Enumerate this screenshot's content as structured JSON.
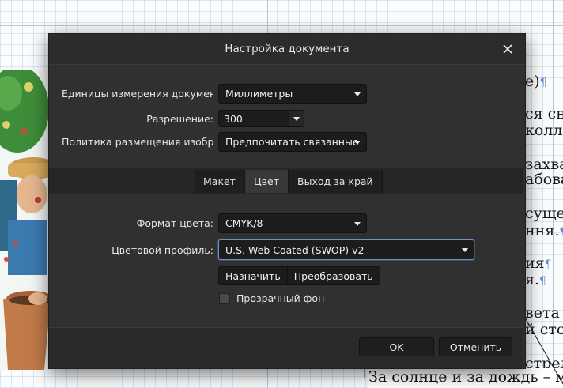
{
  "background": {
    "text_lines": [
      {
        "text": "е)",
        "pilcrow": "¶"
      },
      {
        "text": "ся сно",
        "pilcrow": ""
      },
      {
        "text": "колле",
        "pilcrow": ""
      },
      {
        "text": "захва",
        "pilcrow": ""
      },
      {
        "text": "абова",
        "pilcrow": ""
      },
      {
        "text": "суще",
        "pilcrow": ""
      },
      {
        "text": "ння.",
        "pilcrow": "¶"
      },
      {
        "text": "ия",
        "pilcrow": "¶"
      },
      {
        "text": "я.",
        "pilcrow": "¶"
      },
      {
        "text": "вета х",
        "pilcrow": ""
      },
      {
        "text": "й стор",
        "pilcrow": ""
      },
      {
        "text": "стрель",
        "pilcrow": ""
      }
    ],
    "bottom_line": "За солнце и за дождь – мо"
  },
  "dialog": {
    "title": "Настройка документа",
    "close_icon": "close-icon",
    "fields": {
      "units_label": "Единицы измерения докумен",
      "units_value": "Миллиметры",
      "resolution_label": "Разрешение:",
      "resolution_value": "300",
      "placement_label": "Политика размещения изобр",
      "placement_value": "Предпочитать связанные"
    },
    "tabs": [
      {
        "label": "Макет",
        "active": false
      },
      {
        "label": "Цвет",
        "active": true
      },
      {
        "label": "Выход за край",
        "active": false
      }
    ],
    "color": {
      "format_label": "Формат цвета:",
      "format_value": "CMYK/8",
      "profile_label": "Цветовой профиль:",
      "profile_value": "U.S. Web Coated (SWOP) v2",
      "assign_label": "Назначить",
      "convert_label": "Преобразовать",
      "transparent_label": "Прозрачный фон",
      "transparent_checked": false
    },
    "footer": {
      "ok_label": "OK",
      "cancel_label": "Отменить"
    }
  },
  "colors": {
    "dialog_bg": "#303030",
    "accent_focus": "#6f8fc9",
    "pilcrow": "#5c8fd6"
  }
}
